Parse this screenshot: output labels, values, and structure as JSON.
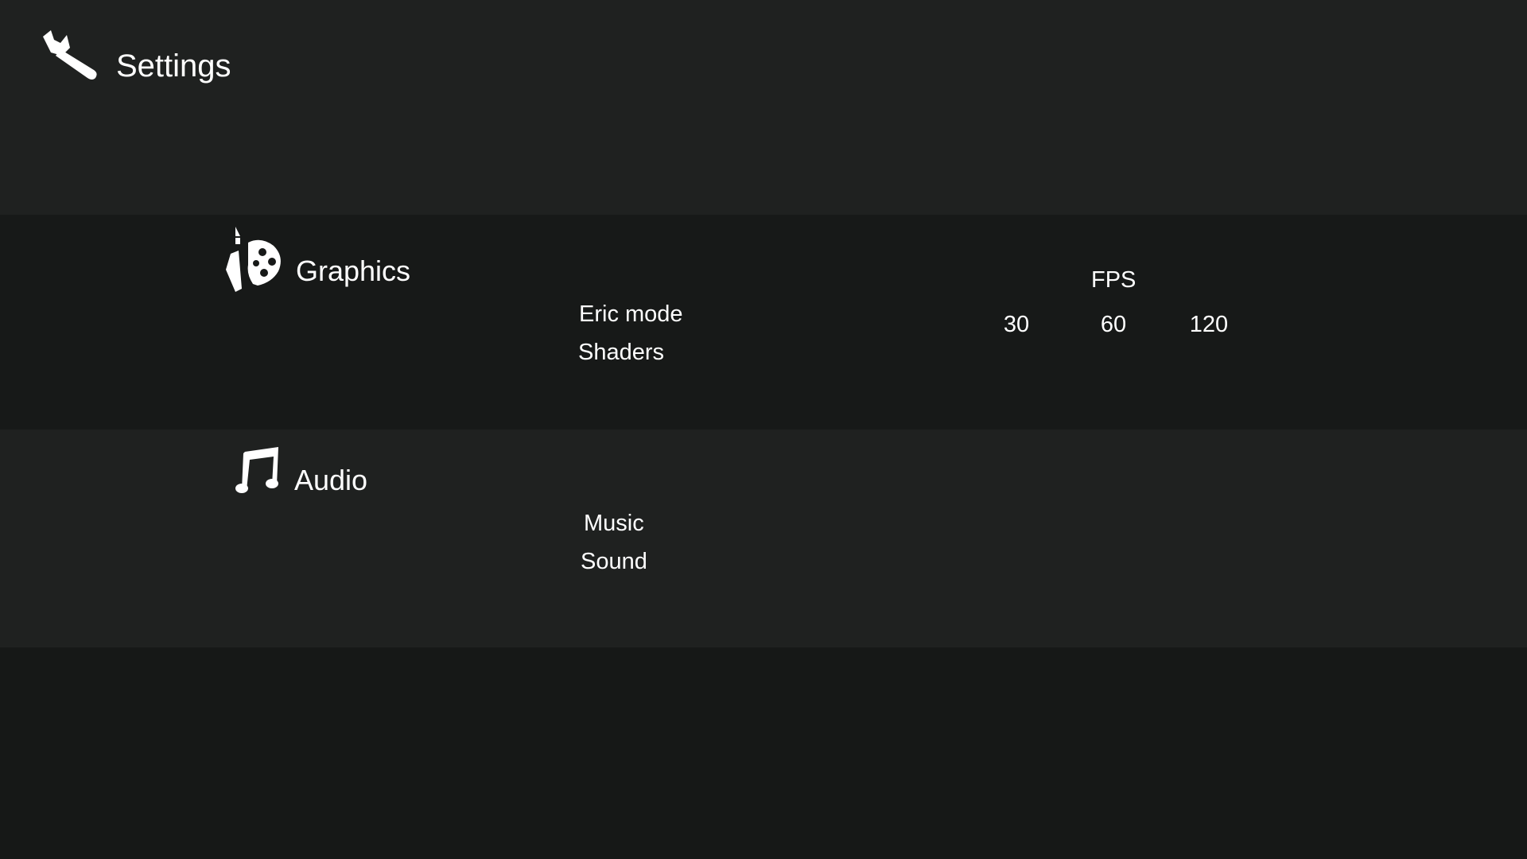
{
  "header": {
    "title": "Settings",
    "icon": "wrench-icon"
  },
  "sections": {
    "graphics": {
      "title": "Graphics",
      "icon": "palette-icon",
      "options": [
        "Eric mode",
        "Shaders"
      ],
      "fps": {
        "label": "FPS",
        "choices": [
          "30",
          "60",
          "120"
        ]
      }
    },
    "audio": {
      "title": "Audio",
      "icon": "music-note-icon",
      "options": [
        "Music",
        "Sound"
      ]
    }
  },
  "colors": {
    "background_light": "#1f2120",
    "background_dark": "#171918",
    "text": "#ffffff"
  }
}
